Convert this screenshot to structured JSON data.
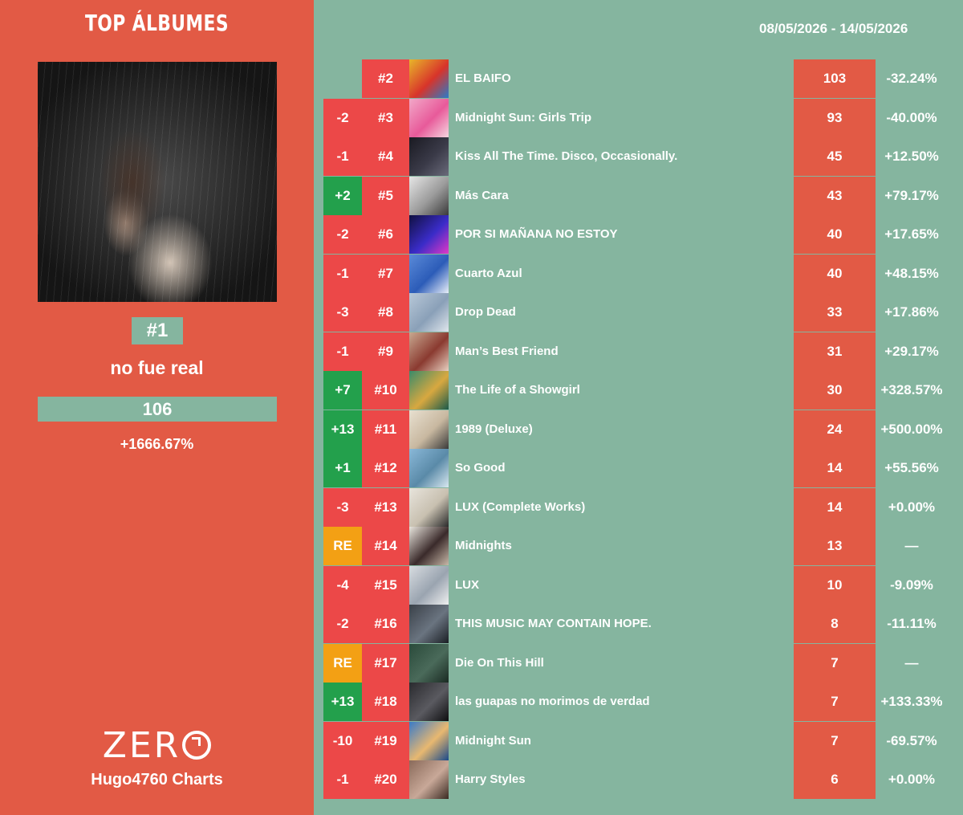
{
  "header": {
    "title": "TOP ÁLBUMES",
    "date_range": "08/05/2026 - 14/05/2026"
  },
  "featured": {
    "rank": "#1",
    "title": "no fue real",
    "points": "106",
    "change_pct": "+1666.67%"
  },
  "branding": {
    "logo_text": "ZER",
    "name": "Hugo4760 Charts"
  },
  "colors": {
    "up": "#23a04c",
    "down": "#ec4848",
    "reentry": "#f3a014",
    "left_panel": "#e25a45",
    "main_bg": "#85b59f"
  },
  "rows": [
    {
      "change": "",
      "change_type": "none",
      "position": "#2",
      "title": "EL BAIFO",
      "points": "103",
      "pct": "-32.24%",
      "art": [
        "#e8b62a",
        "#d8342a",
        "#2b7bc8"
      ]
    },
    {
      "change": "-2",
      "change_type": "down",
      "position": "#3",
      "title": "Midnight Sun: Girls Trip",
      "points": "93",
      "pct": "-40.00%",
      "art": [
        "#f2a8c8",
        "#e85a9a",
        "#f5d6e0"
      ]
    },
    {
      "change": "-1",
      "change_type": "down",
      "position": "#4",
      "title": "Kiss All The Time. Disco, Occasionally.",
      "points": "45",
      "pct": "+12.50%",
      "art": [
        "#1a1a22",
        "#3a3a48",
        "#6a6a7a"
      ]
    },
    {
      "change": "+2",
      "change_type": "up",
      "position": "#5",
      "title": "Más Cara",
      "points": "43",
      "pct": "+79.17%",
      "art": [
        "#e6e6e6",
        "#9a9a9a",
        "#3a3a3a"
      ]
    },
    {
      "change": "-2",
      "change_type": "down",
      "position": "#6",
      "title": "POR SI MAÑANA NO ESTOY",
      "points": "40",
      "pct": "+17.65%",
      "art": [
        "#101040",
        "#3a2cc8",
        "#e038c8"
      ]
    },
    {
      "change": "-1",
      "change_type": "down",
      "position": "#7",
      "title": "Cuarto Azul",
      "points": "40",
      "pct": "+48.15%",
      "art": [
        "#5a8ad8",
        "#2c5cb8",
        "#e8eef8"
      ]
    },
    {
      "change": "-3",
      "change_type": "down",
      "position": "#8",
      "title": "Drop Dead",
      "points": "33",
      "pct": "+17.86%",
      "art": [
        "#b8c8d8",
        "#8aa0b8",
        "#e0e6ec"
      ]
    },
    {
      "change": "-1",
      "change_type": "down",
      "position": "#9",
      "title": "Man’s Best Friend",
      "points": "31",
      "pct": "+29.17%",
      "art": [
        "#c8a890",
        "#8a3a30",
        "#e8d0c0"
      ]
    },
    {
      "change": "+7",
      "change_type": "up",
      "position": "#10",
      "title": "The Life of a Showgirl",
      "points": "30",
      "pct": "+328.57%",
      "art": [
        "#3a8a6a",
        "#d8a840",
        "#1a5a4a"
      ]
    },
    {
      "change": "+13",
      "change_type": "up",
      "position": "#11",
      "title": "1989 (Deluxe)",
      "points": "24",
      "pct": "+500.00%",
      "art": [
        "#e8e0d0",
        "#c8b8a0",
        "#3a3a3a"
      ]
    },
    {
      "change": "+1",
      "change_type": "up",
      "position": "#12",
      "title": "So Good",
      "points": "14",
      "pct": "+55.56%",
      "art": [
        "#8ab8d8",
        "#5a8aa8",
        "#d8e8f0"
      ]
    },
    {
      "change": "-3",
      "change_type": "down",
      "position": "#13",
      "title": "LUX (Complete Works)",
      "points": "14",
      "pct": "+0.00%",
      "art": [
        "#e8e4dc",
        "#c8c0b0",
        "#2a2a2a"
      ]
    },
    {
      "change": "RE",
      "change_type": "re",
      "position": "#14",
      "title": "Midnights",
      "points": "13",
      "pct": "—",
      "art": [
        "#e8e4dc",
        "#3a2a2a",
        "#c8b8a8"
      ]
    },
    {
      "change": "-4",
      "change_type": "down",
      "position": "#15",
      "title": "LUX",
      "points": "10",
      "pct": "-9.09%",
      "art": [
        "#d8dce0",
        "#9aa4b0",
        "#f0f0f0"
      ]
    },
    {
      "change": "-2",
      "change_type": "down",
      "position": "#16",
      "title": "THIS MUSIC MAY CONTAIN HOPE.",
      "points": "8",
      "pct": "-11.11%",
      "art": [
        "#3a4048",
        "#6a7480",
        "#1a1e24"
      ]
    },
    {
      "change": "RE",
      "change_type": "re",
      "position": "#17",
      "title": "Die On This Hill",
      "points": "7",
      "pct": "—",
      "art": [
        "#2a4a3a",
        "#4a6a5a",
        "#1a2a22"
      ]
    },
    {
      "change": "+13",
      "change_type": "up",
      "position": "#18",
      "title": "las guapas no morimos de verdad",
      "points": "7",
      "pct": "+133.33%",
      "art": [
        "#2a2a2e",
        "#5a5a60",
        "#0e0e10"
      ]
    },
    {
      "change": "-10",
      "change_type": "down",
      "position": "#19",
      "title": "Midnight Sun",
      "points": "7",
      "pct": "-69.57%",
      "art": [
        "#3a7ac8",
        "#e8b870",
        "#1a4a8a"
      ]
    },
    {
      "change": "-1",
      "change_type": "down",
      "position": "#20",
      "title": "Harry Styles",
      "points": "6",
      "pct": "+0.00%",
      "art": [
        "#8a6a5a",
        "#c8a898",
        "#3a2a22"
      ]
    }
  ]
}
